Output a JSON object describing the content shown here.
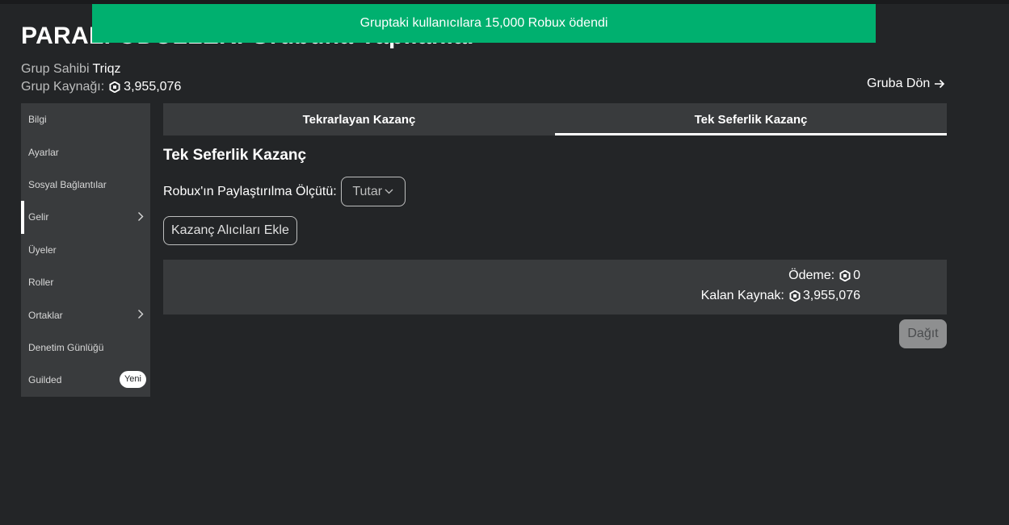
{
  "page": {
    "title": "PARALI ÖDÜLLERİ Grubuna Yapılanlar"
  },
  "toast": {
    "message": "Gruptaki kullanıcılara 15,000 Robux ödendi",
    "color": "#00b06f"
  },
  "group": {
    "owner_label": "Grup Sahibi",
    "owner_name": "Triqz",
    "funds_label": "Grup Kaynağı:",
    "funds_value": "3,955,076",
    "funds_icon": "robux-icon"
  },
  "back_link": {
    "label": "Gruba Dön",
    "icon": "arrow-right-icon"
  },
  "sidebar": {
    "items": [
      {
        "label": "Bilgi"
      },
      {
        "label": "Ayarlar"
      },
      {
        "label": "Sosyal Bağlantılar"
      },
      {
        "label": "Gelir",
        "active": true,
        "icon": "chevron-right-icon"
      },
      {
        "label": "Üyeler"
      },
      {
        "label": "Roller"
      },
      {
        "label": "Ortaklar",
        "icon": "chevron-right-icon"
      },
      {
        "label": "Denetim Günlüğü"
      },
      {
        "label": "Guilded",
        "badge": "Yeni"
      }
    ]
  },
  "tabs": [
    {
      "label": "Tekrarlayan Kazanç",
      "active": false
    },
    {
      "label": "Tek Seferlik Kazanç",
      "active": true
    }
  ],
  "main": {
    "section_title": "Tek Seferlik Kazanç",
    "criteria_label": "Robux'ın Paylaştırılma Ölçütü:",
    "criteria_value": "Tutar",
    "add_button": "Kazanç Alıcıları Ekle",
    "payout_label": "Ödeme:",
    "payout_value": "0",
    "remaining_label": "Kalan Kaynak:",
    "remaining_value": "3,955,076",
    "distribute_button": "Dağıt"
  },
  "colors": {
    "background": "#232527",
    "panel": "#393b3d",
    "accent_green": "#00b06f",
    "disabled_button": "#8e8f90"
  }
}
